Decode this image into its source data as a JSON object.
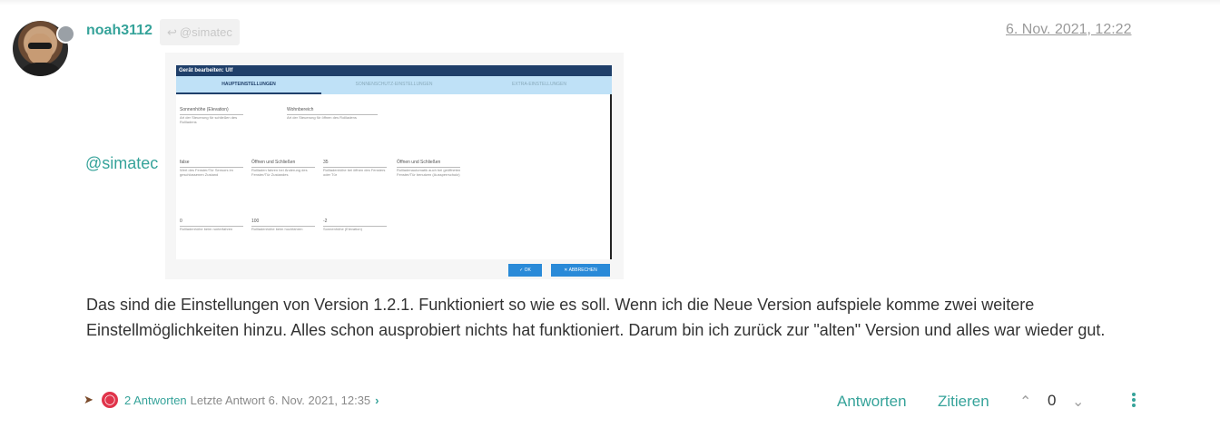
{
  "post": {
    "username": "noah3112",
    "reply_to": "@simatec",
    "timestamp": "6. Nov. 2021, 12:22",
    "mention": "@simatec",
    "body": "Das sind die Einstellungen von Version 1.2.1. Funktioniert so wie es soll. Wenn ich die Neue Version aufspiele komme zwei weitere Einstellmöglichkeiten hinzu. Alles schon ausprobiert nichts hat funktioniert. Darum bin ich zurück zur \"alten\" Version und alles war wieder gut."
  },
  "screenshot": {
    "title": "Gerät bearbeiten: Ulf",
    "tabs": [
      "HAUPTEINSTELLUNGEN",
      "SONNENSCHUTZ-EINSTELLUNGEN",
      "EXTRA-EINSTELLUNGEN"
    ],
    "row1": [
      {
        "value": "Sonnenhöhe (Elevation)",
        "label": "Art der Steuerung für schließen des Rollladens"
      },
      {
        "value": "Wohnbereich",
        "label": "Art der Steuerung für öffnen des Rollladens"
      }
    ],
    "row2": [
      {
        "value": "false",
        "label": "Wert des Fenster/Tür Sensors im geschlossenen Zustand"
      },
      {
        "value": "Öffnen und Schließen",
        "label": "Rollladen fahren bei Änderung des Fenster/Tür Zustandes"
      },
      {
        "value": "35",
        "label": "Rollladenhöhe bei öffnen des Fensters oder Tür"
      },
      {
        "value": "Öffnen und Schließen",
        "label": "Rollladenautomatik auch bei geöffneten Fenster/Tür benutzen (Aussperrschutz)"
      }
    ],
    "row3": [
      {
        "value": "0",
        "label": "Rollladenhöhe beim runterfahren"
      },
      {
        "value": "100",
        "label": "Rollladenhöhe beim hochfahren"
      },
      {
        "value": "-2",
        "label": "Sonnenhöhe (Elevation)"
      }
    ],
    "ok_label": "OK",
    "cancel_label": "ABBRECHEN"
  },
  "footer": {
    "replies": "2 Antworten",
    "last_reply": "Letzte Antwort 6. Nov. 2021, 12:35",
    "reply_action": "Antworten",
    "quote_action": "Zitieren",
    "votes": "0"
  },
  "colors": {
    "accent": "#36a39a",
    "status": "#9aa0a6"
  }
}
